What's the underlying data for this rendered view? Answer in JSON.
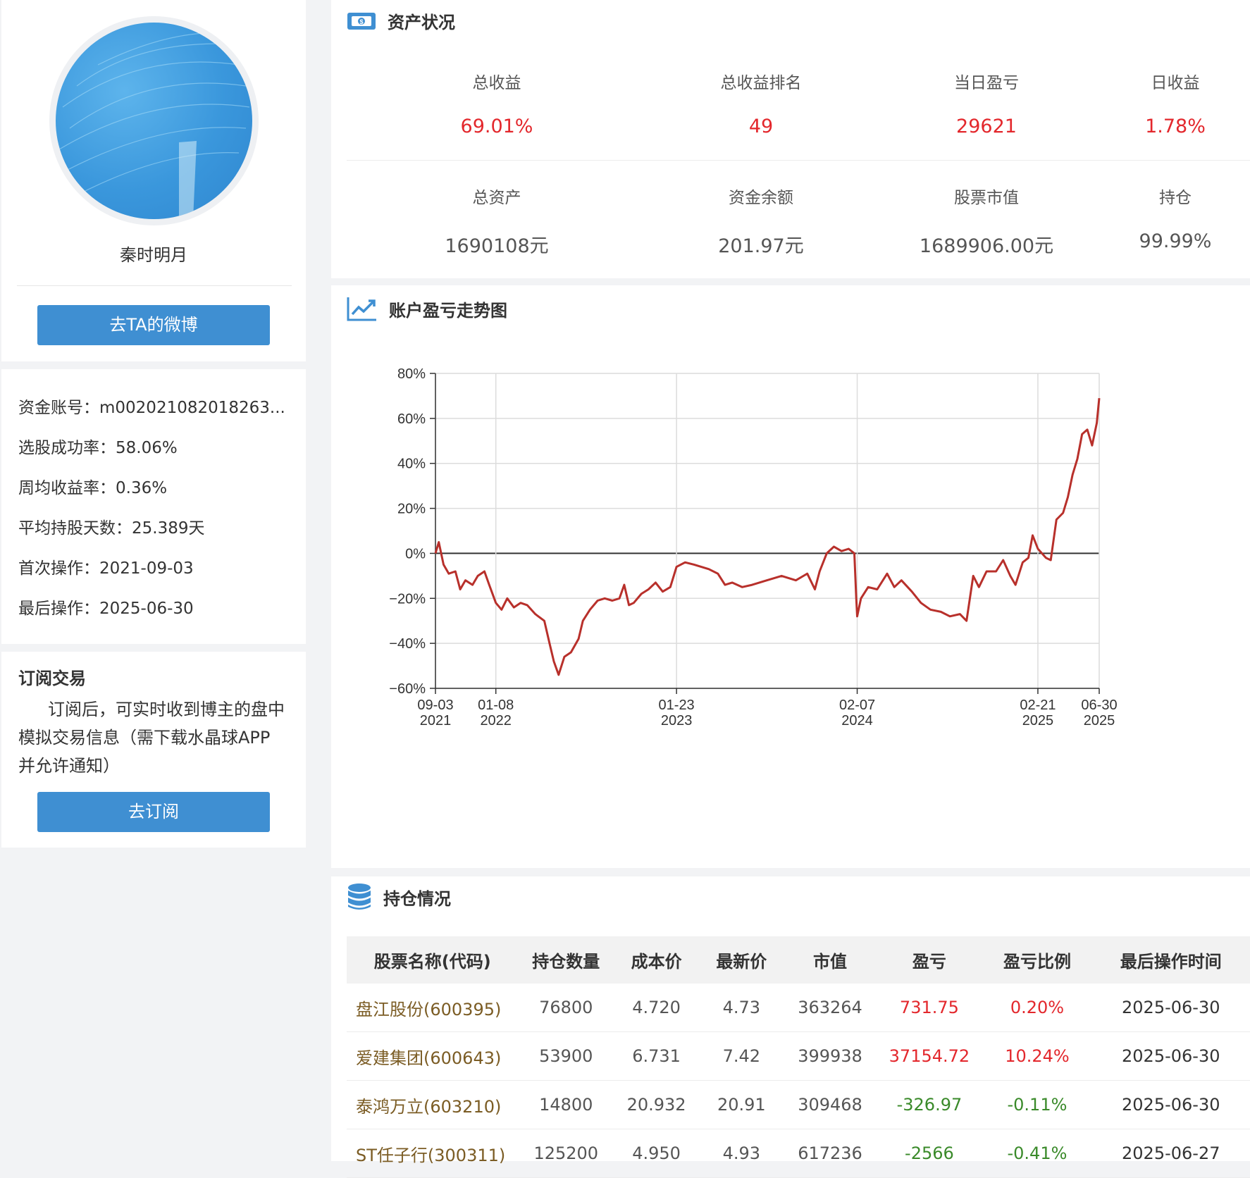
{
  "profile": {
    "nickname": "秦时明月",
    "weibo_button": "去TA的微博"
  },
  "stats": {
    "account": "资金账号：m002021082018263...",
    "success_rate": "选股成功率：58.06%",
    "weekly_return": "周均收益率：0.36%",
    "avg_hold_days": "平均持股天数：25.389天",
    "first_op": "首次操作：2021-09-03",
    "last_op": "最后操作：2025-06-30"
  },
  "subscribe": {
    "title": "订阅交易",
    "desc": "订阅后，可实时收到博主的盘中模拟交易信息（需下载水晶球APP并允许通知）",
    "button": "去订阅"
  },
  "assets": {
    "title": "资产状况",
    "row1": [
      {
        "label": "总收益",
        "value": "69.01%",
        "color": "red"
      },
      {
        "label": "总收益排名",
        "value": "49",
        "color": "red"
      },
      {
        "label": "当日盈亏",
        "value": "29621",
        "color": "red"
      },
      {
        "label": "日收益",
        "value": "1.78%",
        "color": "red"
      }
    ],
    "row2": [
      {
        "label": "总资产",
        "value": "1690108元",
        "color": "gray"
      },
      {
        "label": "资金余额",
        "value": "201.97元",
        "color": "gray"
      },
      {
        "label": "股票市值",
        "value": "1689906.00元",
        "color": "gray"
      },
      {
        "label": "持仓",
        "value": "99.99%",
        "color": "gray"
      }
    ]
  },
  "trend": {
    "title": "账户盈亏走势图"
  },
  "chart_data": {
    "type": "line",
    "series": [
      {
        "values": [
          [
            "2021-09-03",
            0
          ],
          [
            "2021-09-10",
            5
          ],
          [
            "2021-09-20",
            -5
          ],
          [
            "2021-10-01",
            -9
          ],
          [
            "2021-10-15",
            -8
          ],
          [
            "2021-10-25",
            -16
          ],
          [
            "2021-11-05",
            -12
          ],
          [
            "2021-11-20",
            -14
          ],
          [
            "2021-12-01",
            -10
          ],
          [
            "2021-12-15",
            -8
          ],
          [
            "2021-12-25",
            -14
          ],
          [
            "2022-01-08",
            -22
          ],
          [
            "2022-01-20",
            -25
          ],
          [
            "2022-02-01",
            -20
          ],
          [
            "2022-02-15",
            -24
          ],
          [
            "2022-03-01",
            -22
          ],
          [
            "2022-03-15",
            -23
          ],
          [
            "2022-04-01",
            -27
          ],
          [
            "2022-04-20",
            -30
          ],
          [
            "2022-05-01",
            -40
          ],
          [
            "2022-05-10",
            -48
          ],
          [
            "2022-05-20",
            -54
          ],
          [
            "2022-06-01",
            -46
          ],
          [
            "2022-06-15",
            -44
          ],
          [
            "2022-07-01",
            -38
          ],
          [
            "2022-07-10",
            -30
          ],
          [
            "2022-07-25",
            -25
          ],
          [
            "2022-08-10",
            -21
          ],
          [
            "2022-08-25",
            -20
          ],
          [
            "2022-09-10",
            -21
          ],
          [
            "2022-09-25",
            -20
          ],
          [
            "2022-10-05",
            -14
          ],
          [
            "2022-10-15",
            -23
          ],
          [
            "2022-10-25",
            -22
          ],
          [
            "2022-11-10",
            -18
          ],
          [
            "2022-11-25",
            -16
          ],
          [
            "2022-12-10",
            -13
          ],
          [
            "2022-12-25",
            -17
          ],
          [
            "2023-01-10",
            -15
          ],
          [
            "2023-01-23",
            -6
          ],
          [
            "2023-02-10",
            -4
          ],
          [
            "2023-03-01",
            -5
          ],
          [
            "2023-04-01",
            -7
          ],
          [
            "2023-04-20",
            -9
          ],
          [
            "2023-05-05",
            -14
          ],
          [
            "2023-05-20",
            -13
          ],
          [
            "2023-06-10",
            -15
          ],
          [
            "2023-07-01",
            -14
          ],
          [
            "2023-08-01",
            -12
          ],
          [
            "2023-09-01",
            -10
          ],
          [
            "2023-10-01",
            -12
          ],
          [
            "2023-10-25",
            -9
          ],
          [
            "2023-11-10",
            -16
          ],
          [
            "2023-11-20",
            -8
          ],
          [
            "2023-12-05",
            0
          ],
          [
            "2023-12-20",
            3
          ],
          [
            "2024-01-05",
            1
          ],
          [
            "2024-01-20",
            2
          ],
          [
            "2024-02-01",
            0
          ],
          [
            "2024-02-05",
            -20
          ],
          [
            "2024-02-07",
            -28
          ],
          [
            "2024-02-15",
            -20
          ],
          [
            "2024-03-01",
            -15
          ],
          [
            "2024-03-20",
            -16
          ],
          [
            "2024-04-10",
            -9
          ],
          [
            "2024-04-25",
            -15
          ],
          [
            "2024-05-10",
            -12
          ],
          [
            "2024-06-01",
            -17
          ],
          [
            "2024-06-20",
            -22
          ],
          [
            "2024-07-10",
            -25
          ],
          [
            "2024-08-01",
            -26
          ],
          [
            "2024-08-20",
            -28
          ],
          [
            "2024-09-10",
            -27
          ],
          [
            "2024-09-24",
            -30
          ],
          [
            "2024-10-08",
            -10
          ],
          [
            "2024-10-20",
            -15
          ],
          [
            "2024-11-05",
            -8
          ],
          [
            "2024-11-25",
            -8
          ],
          [
            "2024-12-10",
            -3
          ],
          [
            "2024-12-25",
            -10
          ],
          [
            "2025-01-05",
            -14
          ],
          [
            "2025-01-20",
            -4
          ],
          [
            "2025-02-01",
            -2
          ],
          [
            "2025-02-10",
            8
          ],
          [
            "2025-02-21",
            2
          ],
          [
            "2025-03-10",
            -2
          ],
          [
            "2025-03-20",
            -3
          ],
          [
            "2025-04-01",
            15
          ],
          [
            "2025-04-15",
            18
          ],
          [
            "2025-04-25",
            25
          ],
          [
            "2025-05-05",
            35
          ],
          [
            "2025-05-15",
            42
          ],
          [
            "2025-05-25",
            53
          ],
          [
            "2025-06-05",
            55
          ],
          [
            "2025-06-15",
            48
          ],
          [
            "2025-06-25",
            58
          ],
          [
            "2025-06-30",
            69
          ]
        ]
      }
    ],
    "ylim": [
      -60,
      80
    ],
    "yticks": [
      "80%",
      "60%",
      "40%",
      "20%",
      "0%",
      "-20%",
      "-40%",
      "-60%"
    ],
    "xticks": [
      {
        "date": "2021-09-03",
        "label1": "09-03",
        "label2": "2021"
      },
      {
        "date": "2022-01-08",
        "label1": "01-08",
        "label2": "2022"
      },
      {
        "date": "2023-01-23",
        "label1": "01-23",
        "label2": "2023"
      },
      {
        "date": "2024-02-07",
        "label1": "02-07",
        "label2": "2024"
      },
      {
        "date": "2025-02-21",
        "label1": "02-21",
        "label2": "2025"
      },
      {
        "date": "2025-06-30",
        "label1": "06-30",
        "label2": "2025"
      }
    ],
    "line_color": "#b8302b",
    "grid": true
  },
  "holdings": {
    "title": "持仓情况",
    "headers": [
      "股票名称(代码)",
      "持仓数量",
      "成本价",
      "最新价",
      "市值",
      "盈亏",
      "盈亏比例",
      "最后操作时间"
    ],
    "rows": [
      {
        "name": "盘江股份(600395)",
        "qty": "76800",
        "cost": "4.720",
        "price": "4.73",
        "mv": "363264",
        "pnl": "731.75",
        "ratio": "0.20%",
        "date": "2025-06-30",
        "sign": "pos"
      },
      {
        "name": "爱建集团(600643)",
        "qty": "53900",
        "cost": "6.731",
        "price": "7.42",
        "mv": "399938",
        "pnl": "37154.72",
        "ratio": "10.24%",
        "date": "2025-06-30",
        "sign": "pos"
      },
      {
        "name": "泰鸿万立(603210)",
        "qty": "14800",
        "cost": "20.932",
        "price": "20.91",
        "mv": "309468",
        "pnl": "-326.97",
        "ratio": "-0.11%",
        "date": "2025-06-30",
        "sign": "neg"
      },
      {
        "name": "ST任子行(300311)",
        "qty": "125200",
        "cost": "4.950",
        "price": "4.93",
        "mv": "617236",
        "pnl": "-2566",
        "ratio": "-0.41%",
        "date": "2025-06-27",
        "sign": "neg"
      }
    ]
  },
  "colors": {
    "accent": "#3f8fd2",
    "positive": "#e3272c",
    "negative": "#3a8a2a",
    "stock_name": "#7b5c24"
  }
}
